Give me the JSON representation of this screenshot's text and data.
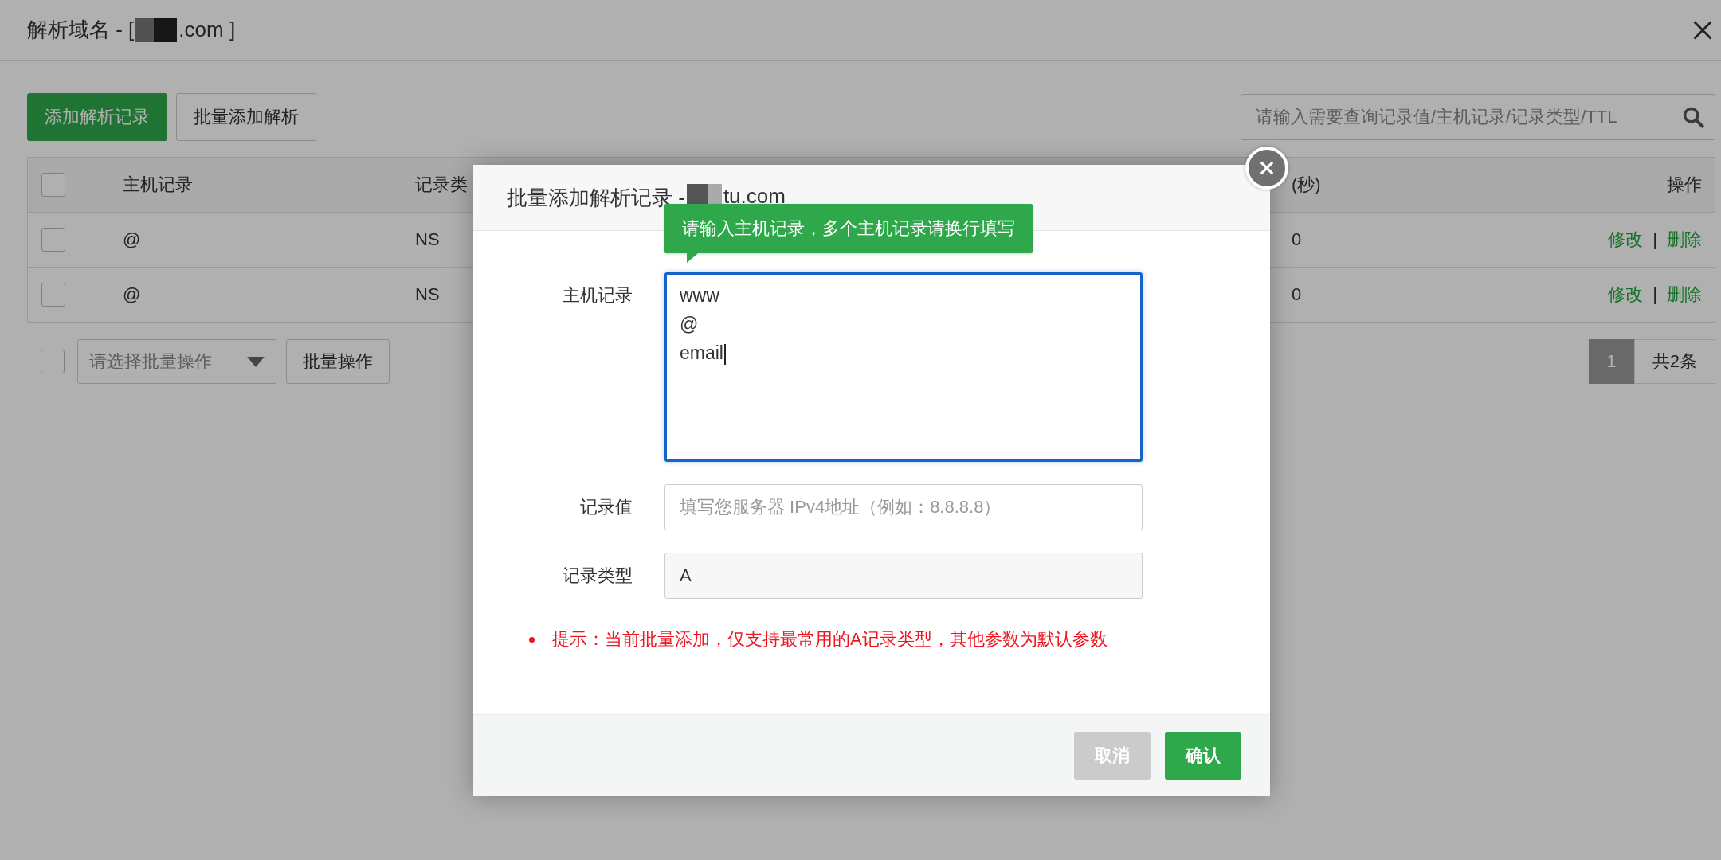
{
  "page": {
    "title_start": "解析域名 - [",
    "title_end": ".com ]"
  },
  "toolbar": {
    "buttons": [
      {
        "label": "添加解析记录",
        "kind": "primary"
      },
      {
        "label": "批量添加解析",
        "kind": "default"
      }
    ],
    "search": {
      "placeholder": "请输入需要查询记录值/主机记录/记录类型/TTL"
    }
  },
  "table": {
    "select_all": {
      "checked": false
    },
    "columns": [
      "主机记录",
      "记录类",
      "(秒)",
      "操作"
    ],
    "action_separator": "|",
    "rows": [
      {
        "checked": false,
        "cells": [
          "@",
          "NS",
          "0"
        ],
        "actions": [
          "修改",
          "删除"
        ]
      },
      {
        "checked": false,
        "cells": [
          "@",
          "NS",
          "0"
        ],
        "actions": [
          "修改",
          "删除"
        ]
      }
    ]
  },
  "bulk": {
    "checkbox": {
      "checked": false
    },
    "select": {
      "placeholder": "请选择批量操作"
    },
    "button": "批量操作"
  },
  "pagination": {
    "pages": [
      {
        "label": "1",
        "selected": true
      }
    ],
    "total": "共2条"
  },
  "modal": {
    "title_start": "批量添加解析记录 - ",
    "title_end": "tu.com",
    "tooltip": "请输入主机记录，多个主机记录请换行填写",
    "fields": [
      {
        "label": "主机记录",
        "kind": "textarea",
        "value": "www\n@\nemail",
        "focused": true
      },
      {
        "label": "记录值",
        "kind": "input",
        "placeholder": "填写您服务器 IPv4地址（例如：8.8.8.8）",
        "focused": false
      },
      {
        "label": "记录类型",
        "kind": "readonly",
        "value": "A",
        "focused": false
      }
    ],
    "tip": "提示：当前批量添加，仅支持最常用的A记录类型，其他参数为默认参数",
    "buttons": [
      {
        "label": "取消",
        "kind": "cancel"
      },
      {
        "label": "确认",
        "kind": "confirm"
      }
    ]
  }
}
